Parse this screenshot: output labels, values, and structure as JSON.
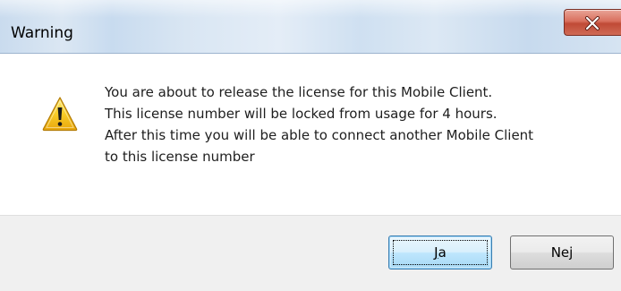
{
  "window": {
    "title": "Warning"
  },
  "dialog": {
    "icon": "warning-icon",
    "message_lines": [
      "You are about to release the license for this Mobile Client.",
      "This license number will be locked from usage for 4 hours.",
      "After this time you will be able to connect another Mobile Client",
      "to this license number"
    ]
  },
  "buttons": {
    "yes": {
      "prefix": "",
      "accesskey": "J",
      "suffix": "a"
    },
    "no": {
      "prefix": "Ne",
      "accesskey": "j",
      "suffix": ""
    }
  },
  "colors": {
    "close_button": "#c9503c",
    "warning_yellow": "#f6c21b",
    "footer_bg": "#f0f0f0",
    "default_button_border": "#3c7fb1"
  }
}
